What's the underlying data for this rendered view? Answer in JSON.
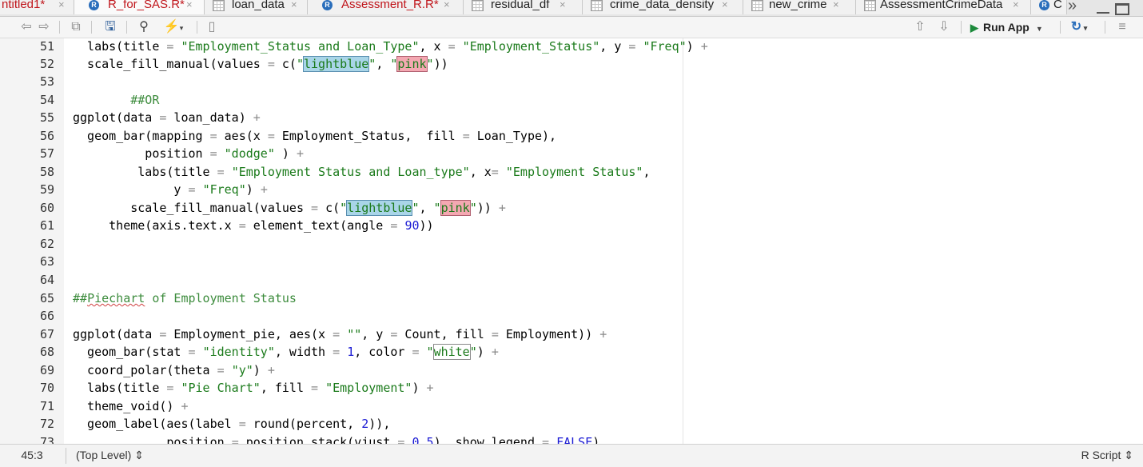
{
  "tabs": [
    {
      "label": "ntitled1*",
      "modified": true,
      "icon": "none"
    },
    {
      "label": "R_for_SAS.R*",
      "modified": true,
      "icon": "r-file-icon"
    },
    {
      "label": "loan_data",
      "modified": false,
      "icon": "data-grid-icon"
    },
    {
      "label": "Assessment_R.R*",
      "modified": true,
      "icon": "r-file-icon"
    },
    {
      "label": "residual_df",
      "modified": false,
      "icon": "data-grid-icon"
    },
    {
      "label": "crime_data_density",
      "modified": false,
      "icon": "data-grid-icon"
    },
    {
      "label": "new_crime",
      "modified": false,
      "icon": "data-grid-icon"
    },
    {
      "label": "AssessmentCrimeData",
      "modified": false,
      "icon": "data-grid-icon"
    },
    {
      "label": "C",
      "modified": false,
      "icon": "r-file-icon"
    }
  ],
  "tab_close_glyph": "×",
  "tab_overflow": "»",
  "toolbar": {
    "run_app_label": "Run App",
    "icons": [
      "back-arrow-icon",
      "forward-arrow-icon",
      "show-in-window-icon",
      "save-icon",
      "search-icon",
      "magic-wand-icon",
      "compile-report-icon",
      "go-up-icon",
      "go-down-icon",
      "publish-icon",
      "outline-icon"
    ]
  },
  "colors": {
    "accent_modified": "#c0151b",
    "string": "#1a7a1a",
    "number": "#1b1bd4",
    "run_green": "#1c8a3b"
  },
  "editor": {
    "lines": [
      {
        "n": "51"
      },
      {
        "n": "52"
      },
      {
        "n": "53"
      },
      {
        "n": "54"
      },
      {
        "n": "55"
      },
      {
        "n": "56"
      },
      {
        "n": "57"
      },
      {
        "n": "58"
      },
      {
        "n": "59"
      },
      {
        "n": "60"
      },
      {
        "n": "61"
      },
      {
        "n": "62"
      },
      {
        "n": "63"
      },
      {
        "n": "64"
      },
      {
        "n": "65"
      },
      {
        "n": "66"
      },
      {
        "n": "67"
      },
      {
        "n": "68"
      },
      {
        "n": "69"
      },
      {
        "n": "70"
      },
      {
        "n": "71"
      },
      {
        "n": "72"
      },
      {
        "n": "73"
      }
    ],
    "code": {
      "l51": [
        "  labs(title ",
        "=",
        " ",
        "\"Employment_Status and Loan_Type\"",
        ", x ",
        "=",
        " ",
        "\"Employment_Status\"",
        ", y ",
        "=",
        " ",
        "\"Freq\"",
        ") ",
        "+"
      ],
      "l52": [
        "  scale_fill_manual(values ",
        "=",
        " c(",
        "\"",
        "lightblue",
        "\"",
        ", ",
        "\"",
        "pink",
        "\"",
        "))"
      ],
      "l54": [
        "        ",
        "##OR"
      ],
      "l55": [
        "ggplot(data ",
        "=",
        " loan_data) ",
        "+"
      ],
      "l56": [
        "  geom_bar(mapping ",
        "=",
        " aes(x ",
        "=",
        " Employment_Status,  fill ",
        "=",
        " Loan_Type),"
      ],
      "l57": [
        "          position ",
        "=",
        " ",
        "\"dodge\"",
        " ) ",
        "+"
      ],
      "l58": [
        "         labs(title ",
        "=",
        " ",
        "\"Employment Status and Loan_type\"",
        ", x",
        "=",
        " ",
        "\"Employment Status\"",
        ","
      ],
      "l59": [
        "              y ",
        "=",
        " ",
        "\"Freq\"",
        ") ",
        "+"
      ],
      "l60": [
        "        scale_fill_manual(values ",
        "=",
        " c(",
        "\"",
        "lightblue",
        "\"",
        ", ",
        "\"",
        "pink",
        "\"",
        ")) ",
        "+"
      ],
      "l61": [
        "     theme(axis.text.x ",
        "=",
        " element_text(angle ",
        "=",
        " ",
        "90",
        "))"
      ],
      "l65": [
        "##",
        "Piechart",
        " of Employment Status"
      ],
      "l67": [
        "ggplot(data ",
        "=",
        " Employment_pie, aes(x ",
        "=",
        " ",
        "\"\"",
        ", y ",
        "=",
        " Count, fill ",
        "=",
        " Employment)) ",
        "+"
      ],
      "l68": [
        "  geom_bar(stat ",
        "=",
        " ",
        "\"identity\"",
        ", width ",
        "=",
        " ",
        "1",
        ", color ",
        "=",
        " ",
        "\"",
        "white",
        "\"",
        ") ",
        "+"
      ],
      "l69": [
        "  coord_polar(theta ",
        "=",
        " ",
        "\"y\"",
        ") ",
        "+"
      ],
      "l70": [
        "  labs(title ",
        "=",
        " ",
        "\"Pie Chart\"",
        ", fill ",
        "=",
        " ",
        "\"Employment\"",
        ") ",
        "+"
      ],
      "l71": [
        "  theme_void() ",
        "+"
      ],
      "l72": [
        "  geom_label(aes(label ",
        "=",
        " round(percent, ",
        "2",
        ")),"
      ],
      "l73": [
        "             position ",
        "=",
        " position_stack(vjust ",
        "=",
        " ",
        "0.5",
        "), show.legend ",
        "=",
        " ",
        "FALSE",
        ")"
      ]
    }
  },
  "status": {
    "cursor_position": "45:3",
    "scope": "(Top Level) ⇕",
    "file_type": "R Script ⇕"
  }
}
